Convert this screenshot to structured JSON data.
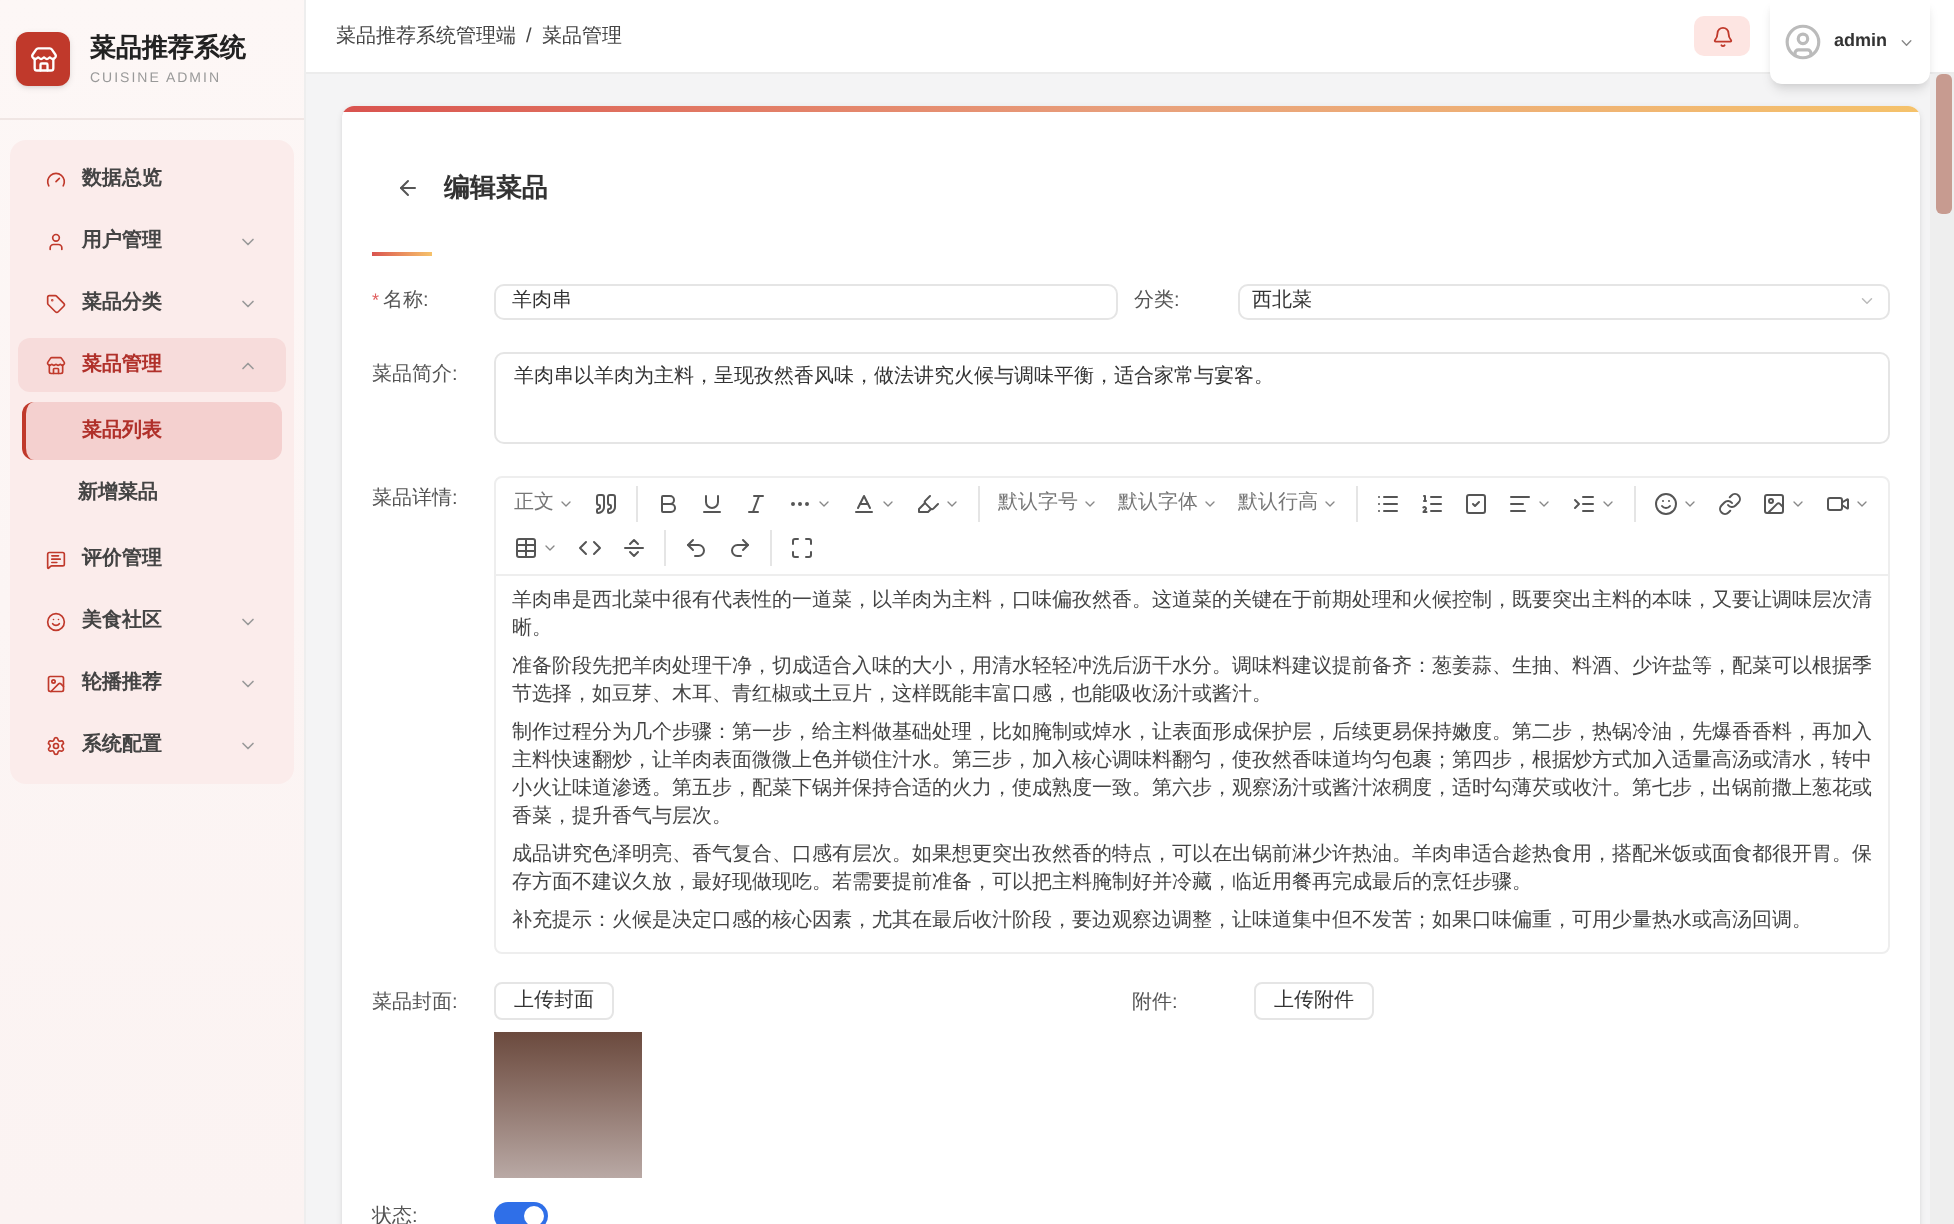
{
  "sidebar": {
    "brand_title": "菜品推荐系统",
    "brand_subtitle": "CUISINE ADMIN",
    "items": [
      {
        "label": "数据总览",
        "selected": false
      },
      {
        "label": "用户管理",
        "selected": false,
        "expanded": false
      },
      {
        "label": "菜品分类",
        "selected": false,
        "expanded": false
      },
      {
        "label": "菜品管理",
        "selected": true,
        "expanded": true,
        "children": [
          {
            "label": "菜品列表",
            "selected": true
          },
          {
            "label": "新增菜品",
            "selected": false
          }
        ]
      },
      {
        "label": "评价管理",
        "selected": false
      },
      {
        "label": "美食社区",
        "selected": false,
        "expanded": false
      },
      {
        "label": "轮播推荐",
        "selected": false,
        "expanded": false
      },
      {
        "label": "系统配置",
        "selected": false,
        "expanded": false
      }
    ]
  },
  "header": {
    "breadcrumb": [
      "菜品推荐系统管理端",
      "菜品管理"
    ],
    "separator": "/",
    "user": "admin"
  },
  "page": {
    "title": "编辑菜品"
  },
  "form": {
    "name": {
      "required_mark": "*",
      "label": "名称:",
      "value": "羊肉串"
    },
    "category": {
      "label": "分类:",
      "value": "西北菜"
    },
    "intro": {
      "label": "菜品简介:",
      "value": "羊肉串以羊肉为主料，呈现孜然香风味，做法讲究火候与调味平衡，适合家常与宴客。"
    },
    "detail": {
      "label": "菜品详情:",
      "toolbar": [
        "正文",
        "默认字号",
        "默认字体",
        "默认行高"
      ],
      "paragraphs": [
        "羊肉串是西北菜中很有代表性的一道菜，以羊肉为主料，口味偏孜然香。这道菜的关键在于前期处理和火候控制，既要突出主料的本味，又要让调味层次清晰。",
        "准备阶段先把羊肉处理干净，切成适合入味的大小，用清水轻轻冲洗后沥干水分。调味料建议提前备齐：葱姜蒜、生抽、料酒、少许盐等，配菜可以根据季节选择，如豆芽、木耳、青红椒或土豆片，这样既能丰富口感，也能吸收汤汁或酱汁。",
        "制作过程分为几个步骤：第一步，给主料做基础处理，比如腌制或焯水，让表面形成保护层，后续更易保持嫩度。第二步，热锅冷油，先爆香香料，再加入主料快速翻炒，让羊肉表面微微上色并锁住汁水。第三步，加入核心调味料翻匀，使孜然香味道均匀包裹；第四步，根据炒方式加入适量高汤或清水，转中小火让味道渗透。第五步，配菜下锅并保持合适的火力，使成熟度一致。第六步，观察汤汁或酱汁浓稠度，适时勾薄芡或收汁。第七步，出锅前撒上葱花或香菜，提升香气与层次。",
        "成品讲究色泽明亮、香气复合、口感有层次。如果想更突出孜然香的特点，可以在出锅前淋少许热油。羊肉串适合趁热食用，搭配米饭或面食都很开胃。保存方面不建议久放，最好现做现吃。若需要提前准备，可以把主料腌制好并冷藏，临近用餐再完成最后的烹饪步骤。",
        "补充提示：火候是决定口感的核心因素，尤其在最后收汁阶段，要边观察边调整，让味道集中但不发苦；如果口味偏重，可用少量热水或高汤回调。"
      ]
    },
    "cover": {
      "label": "菜品封面:",
      "button": "上传封面"
    },
    "attachment": {
      "label": "附件:",
      "button": "上传附件"
    },
    "status": {
      "label": "状态:",
      "on": true
    }
  }
}
